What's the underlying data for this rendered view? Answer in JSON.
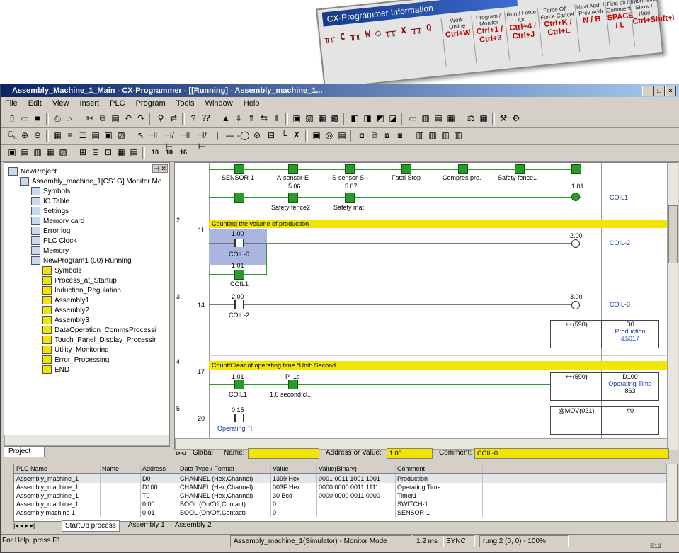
{
  "info_card": {
    "title": "CX-Programmer Information",
    "symbols": "╥╥ C ╥╥ W ◯ ╥╥ X ╥╥ Q",
    "cells": [
      {
        "t": "Work Online",
        "k": "Ctrl+W"
      },
      {
        "t": "Program / Monitor",
        "k": "Ctrl+1 / Ctrl+3"
      },
      {
        "t": "Run / Force On",
        "k": "Ctrl+4 / Ctrl+J"
      },
      {
        "t": "Force Off / Force Cancel",
        "k": "Ctrl+K / Ctrl+L"
      },
      {
        "t": "Next Addr / Prev Addr",
        "k": "N / B"
      },
      {
        "t": "Find bit / Comment",
        "k": "SPACE / L"
      },
      {
        "t": "Information Show / Hide",
        "k": "Ctrl+Shift+I"
      }
    ]
  },
  "window": {
    "title": "Assembly_Machine_1_Main - CX-Programmer - [[Running] - Assembly_machine_1..."
  },
  "menu": [
    "File",
    "Edit",
    "View",
    "Insert",
    "PLC",
    "Program",
    "Tools",
    "Window",
    "Help"
  ],
  "toolbar_numbers": [
    "10",
    "10",
    "16"
  ],
  "tree": [
    {
      "label": "NewProject",
      "indent": 0
    },
    {
      "label": "Assembly_machine_1[CS1G] Monitor Mo",
      "indent": 1
    },
    {
      "label": "Symbols",
      "indent": 2
    },
    {
      "label": "IO Table",
      "indent": 2
    },
    {
      "label": "Settings",
      "indent": 2
    },
    {
      "label": "Memory card",
      "indent": 2
    },
    {
      "label": "Error log",
      "indent": 2
    },
    {
      "label": "PLC Clock",
      "indent": 2
    },
    {
      "label": "Memory",
      "indent": 2
    },
    {
      "label": "NewProgram1 (00) Running",
      "indent": 2
    },
    {
      "label": "Symbols",
      "indent": 3
    },
    {
      "label": "Process_at_Startup",
      "indent": 3
    },
    {
      "label": "Induction_Regulation",
      "indent": 3
    },
    {
      "label": "Assembly1",
      "indent": 3
    },
    {
      "label": "Assembly2",
      "indent": 3
    },
    {
      "label": "Assembly3",
      "indent": 3
    },
    {
      "label": "DataOperation_CommsProcessi",
      "indent": 3
    },
    {
      "label": "Touch_Panel_Display_Processir",
      "indent": 3
    },
    {
      "label": "Utility_Monitoring",
      "indent": 3
    },
    {
      "label": "Error_Processing",
      "indent": 3
    },
    {
      "label": "END",
      "indent": 3
    }
  ],
  "project_tab": "Project",
  "ladder": {
    "rung1": {
      "contacts": [
        "SENSOR-1",
        "A-sensor-E",
        "S-sensor-S",
        "Fatal Stop",
        "Compres.pre.",
        "Safety fence1"
      ],
      "b_addr1": "5.06",
      "b_addr2": "5.07",
      "b_label1": "Safety fence2",
      "b_label2": "Safety mat",
      "coil_addr": "1.01",
      "coil_label": "COIL1"
    },
    "rung2": {
      "rung": "2",
      "step": "11",
      "comment": "Counting the volume of production",
      "c1_addr": "1.00",
      "c1_label": "COIL-0",
      "c2_addr": "1.01",
      "c2_label": "COIL1",
      "coil_addr": "2.00",
      "coil_label": "COIL-2"
    },
    "rung3": {
      "rung": "3",
      "step": "14",
      "c_addr": "2.00",
      "c_label": "COIL-2",
      "coil_addr": "3.00",
      "coil_label": "COIL-3",
      "fb_name": "++(590)",
      "fb_op": "D0",
      "fb_op_label": "Production",
      "fb_val": "&5017"
    },
    "rung4": {
      "rung": "4",
      "step": "17",
      "comment": "Count/Clear of operating time *Unit: Second",
      "c1_addr": "1.01",
      "c1_label": "COIL1",
      "c2_addr": "P_1s",
      "c2_label": "1.0 second cl...",
      "fb_name": "++(590)",
      "fb_op": "D100",
      "fb_op_label": "Operating Time",
      "fb_val": "863"
    },
    "rung5": {
      "rung": "5",
      "step": "20",
      "c_addr": "0.15",
      "c_label": "Operating Ti",
      "fb_name": "@MOV(021)",
      "fb_op": "#0"
    }
  },
  "edit_bar": {
    "global": "Global",
    "name_label": "Name:",
    "addr_label": "Address or Value:",
    "addr_value": "1.00",
    "comment_label": "Comment:",
    "comment_value": "COIL-0"
  },
  "watch": {
    "headers": [
      "PLC Name",
      "Name",
      "Address",
      "Data Type / Format",
      "Value",
      "Value(Binary)",
      "Comment"
    ],
    "rows": [
      [
        "Assembly_machine_1",
        "",
        "D0",
        "CHANNEL (Hex,Channel)",
        "1399 Hex",
        "0001 0011 1001 1001",
        "Production"
      ],
      [
        "Assembly_machine_1",
        "",
        "D100",
        "CHANNEL (Hex,Channel)",
        "003F Hex",
        "0000 0000 0011 1111",
        "Operating Time"
      ],
      [
        "Assembly_machine_1",
        "",
        "T0",
        "CHANNEL (Hex,Channel)",
        "30 Bcd",
        "0000 0000 0011 0000",
        "Timer1"
      ],
      [
        "Assembly_machine_1",
        "",
        "0.00",
        "BOOL (On/Off,Contact)",
        "0",
        "",
        "SWITCH-1"
      ],
      [
        "Assembly machine 1",
        "",
        "0.01",
        "BOOL (On/Off,Contact)",
        "0",
        "",
        "SENSOR-1"
      ]
    ],
    "tabs": [
      "StartUp process",
      "Assembly 1",
      "Assembly 2"
    ]
  },
  "status": {
    "help": "For Help, press F1",
    "mode": "Assembly_machine_1(Simulator) - Monitor Mode",
    "scan": "1.2 ms",
    "sync": "SYNC",
    "pos": "rung 2 (0, 0) - 100%"
  },
  "page_corner": "E12"
}
